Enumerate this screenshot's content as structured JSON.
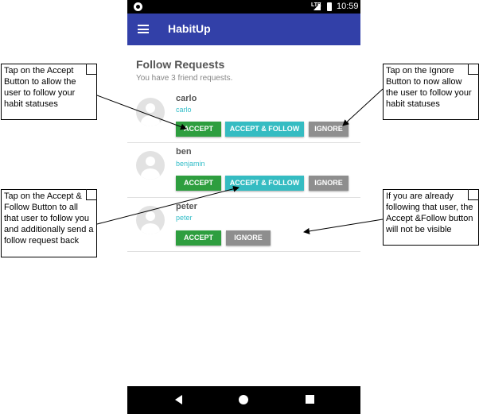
{
  "status_bar": {
    "network": "LTE",
    "time": "10:59"
  },
  "app_bar": {
    "title": "HabitUp",
    "menu_icon": "hamburger-menu-icon"
  },
  "page": {
    "title": "Follow Requests",
    "subtitle": "You have 3 friend requests."
  },
  "requests": [
    {
      "name": "carlo",
      "username": "carlo",
      "buttons": [
        "ACCEPT",
        "ACCEPT & FOLLOW",
        "IGNORE"
      ]
    },
    {
      "name": "ben",
      "username": "benjamin",
      "buttons": [
        "ACCEPT",
        "ACCEPT & FOLLOW",
        "IGNORE"
      ]
    },
    {
      "name": "peter",
      "username": "peter",
      "buttons": [
        "ACCEPT",
        "IGNORE"
      ]
    }
  ],
  "annotations": {
    "accept": "Tap on the Accept Button to allow the user to follow your habit statuses",
    "ignore": "Tap on the Ignore Button to now allow the user to follow your habit statuses",
    "accept_follow": "Tap on the Accept & Follow Button to all that user to follow you and additionally send a follow request back",
    "already_following": "If you are already following that user, the Accept &Follow button will not be visible"
  },
  "colors": {
    "app_bar": "#3240a8",
    "accept": "#2e9e3f",
    "accept_follow": "#35bcc2",
    "ignore": "#8e8e8e",
    "username": "#32bdc8"
  },
  "nav_bar": {
    "icons": [
      "back-icon",
      "home-icon",
      "recent-apps-icon"
    ]
  }
}
